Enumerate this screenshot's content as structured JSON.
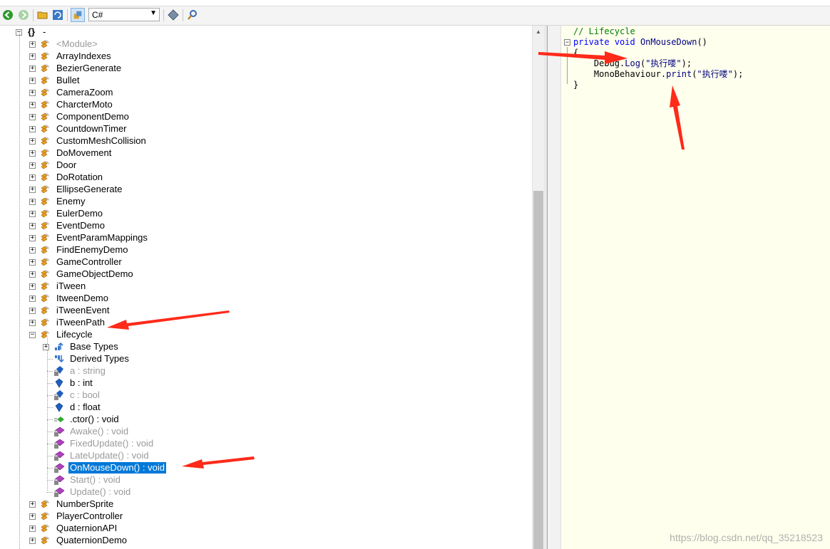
{
  "toolbar": {
    "language": "C#",
    "buttons": [
      "back-icon",
      "forward-icon",
      "open-icon",
      "refresh-icon",
      "compile-icon",
      "language-icon",
      "search-icon"
    ]
  },
  "tree": {
    "root_label": "-",
    "root_glyph": "{}",
    "before": [
      {
        "label": "<Module>",
        "gray": true
      },
      {
        "label": "ArrayIndexes"
      },
      {
        "label": "BezierGenerate"
      },
      {
        "label": "Bullet"
      },
      {
        "label": "CameraZoom"
      },
      {
        "label": "CharcterMoto"
      },
      {
        "label": "ComponentDemo"
      },
      {
        "label": "CountdownTimer"
      },
      {
        "label": "CustomMeshCollision"
      },
      {
        "label": "DoMovement"
      },
      {
        "label": "Door"
      },
      {
        "label": "DoRotation"
      },
      {
        "label": "EllipseGenerate"
      },
      {
        "label": "Enemy"
      },
      {
        "label": "EulerDemo"
      },
      {
        "label": "EventDemo"
      },
      {
        "label": "EventParamMappings"
      },
      {
        "label": "FindEnemyDemo"
      },
      {
        "label": "GameController"
      },
      {
        "label": "GameObjectDemo"
      },
      {
        "label": "iTween"
      },
      {
        "label": "ItweenDemo"
      },
      {
        "label": "iTweenEvent"
      },
      {
        "label": "iTweenPath"
      }
    ],
    "expanded": {
      "label": "Lifecycle"
    },
    "members": [
      {
        "label": "Base Types",
        "kind": "base",
        "expander": true
      },
      {
        "label": "Derived Types",
        "kind": "derived"
      },
      {
        "label": "a : string",
        "kind": "field-private",
        "gray": true
      },
      {
        "label": "b : int",
        "kind": "field-public"
      },
      {
        "label": "c : bool",
        "kind": "field-private",
        "gray": true
      },
      {
        "label": "d : float",
        "kind": "field-public"
      },
      {
        "label": ".ctor() : void",
        "kind": "ctor"
      },
      {
        "label": "Awake() : void",
        "kind": "method-private",
        "gray": true
      },
      {
        "label": "FixedUpdate() : void",
        "kind": "method-private",
        "gray": true
      },
      {
        "label": "LateUpdate() : void",
        "kind": "method-private",
        "gray": true
      },
      {
        "label": "OnMouseDown() : void",
        "kind": "method-private",
        "selected": true
      },
      {
        "label": "Start() : void",
        "kind": "method-private",
        "gray": true
      },
      {
        "label": "Update() : void",
        "kind": "method-private",
        "gray": true
      }
    ],
    "after": [
      {
        "label": "NumberSprite"
      },
      {
        "label": "PlayerController"
      },
      {
        "label": "QuaternionAPI"
      },
      {
        "label": "QuaternionDemo"
      }
    ]
  },
  "code": {
    "comment": "// Lifecycle",
    "kw_private": "private",
    "kw_void": "void",
    "method_name": "OnMouseDown",
    "parens": "()",
    "open_brace": "{",
    "line1_prefix": "Debug.",
    "line1_call": "Log",
    "line1_open": "(",
    "line1_string": "\"执行喽\"",
    "line1_close": ");",
    "line2_prefix": "MonoBehaviour.",
    "line2_call": "print",
    "line2_open": "(",
    "line2_string": "\"执行喽\"",
    "line2_close": ");",
    "close_brace": "}"
  },
  "watermark": "https://blog.csdn.net/qq_35218523",
  "colors": {
    "selection": "#0078d7",
    "code_background": "#ffffee",
    "keyword": "#0000ff",
    "comment": "#008000",
    "string": "#a31515",
    "annotation_arrow": "#ff2a1a"
  }
}
